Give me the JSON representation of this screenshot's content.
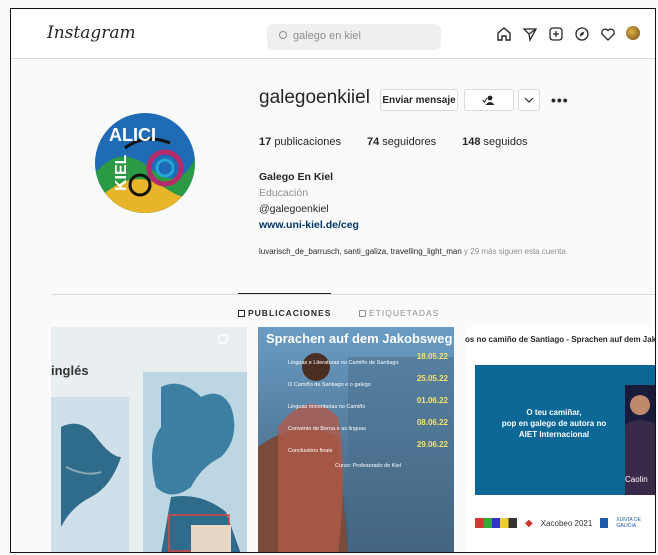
{
  "header": {
    "logo": "Instagram",
    "search_placeholder": "galego en kiel",
    "nav_icons": [
      "home-icon",
      "direct-icon",
      "new-post-icon",
      "explore-icon",
      "heart-icon",
      "avatar"
    ]
  },
  "profile": {
    "username": "galegoenkiiel",
    "message_button": "Enviar mensaje",
    "stats": [
      {
        "count": "17",
        "label": "publicaciones"
      },
      {
        "count": "74",
        "label": "seguidores"
      },
      {
        "count": "148",
        "label": "seguidos"
      }
    ],
    "bio_name": "Galego En Kiel",
    "bio_category": "Educación",
    "bio_handle": "@galegoenkiel",
    "bio_link": "www.uni-kiel.de/ceg",
    "followed_by_names": "luvarisch_de_barrusch, santi_galiza, travelling_light_man",
    "followed_by_rest": "y 29 más siguen esta cuenta",
    "avatar_text": "GALICIA KIEL"
  },
  "tabs": [
    {
      "label": "PUBLICACIONES",
      "icon": "grid-icon"
    },
    {
      "label": "ETIQUETADAS",
      "icon": "tag-icon"
    }
  ],
  "posts": {
    "post1": {
      "caption": "inglés"
    },
    "post2": {
      "title": "Sprachen auf dem Jakobsweg",
      "dates": [
        "18.05.22",
        "25.05.22",
        "01.06.22",
        "08.06.22",
        "29.06.22"
      ],
      "entries": [
        "Linguas e Literaturas no Camiño de Santiago",
        "O Camiño de Santiago e o galego",
        "Linguas minoritarias no Camiño",
        "Convenio de Berna e as linguas",
        "Conclusións finais"
      ],
      "footer": "Curso: Profesorado de Kiel"
    },
    "post3": {
      "title": "os no camiño de Santiago - Sprachen auf dem Jakobsweg",
      "banner_line1": "O teu camiñar,",
      "banner_line2": "pop en galego de autora no",
      "banner_line3": "AIET Internacional",
      "person_name": "Caolin",
      "logo1": "Xacobeo 2021",
      "logo2": "XUNTA DE GALICIA"
    }
  },
  "colors": {
    "link": "#00376b",
    "muted": "#8e8e8e",
    "border": "#dbdbdb",
    "text": "#262626"
  }
}
